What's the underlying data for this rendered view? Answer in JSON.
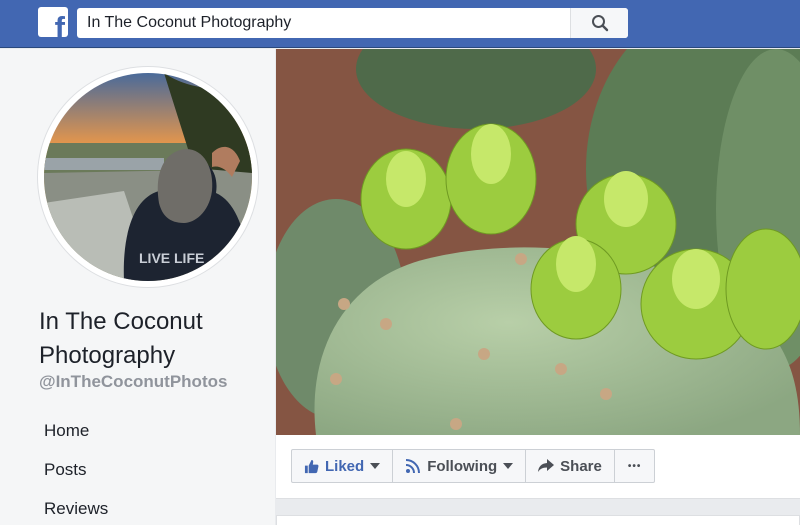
{
  "header": {
    "logo": "facebook-f",
    "search": {
      "value": "In The Coconut Photography",
      "placeholder": "Search"
    },
    "colors": {
      "bar": "#4267b2"
    }
  },
  "profile": {
    "name_line1": "In The Coconut",
    "name_line2": "Photography",
    "handle": "@InTheCoconutPhotos"
  },
  "nav": [
    {
      "label": "Home"
    },
    {
      "label": "Posts"
    },
    {
      "label": "Reviews"
    }
  ],
  "actions": {
    "liked": "Liked",
    "following": "Following",
    "share": "Share",
    "more": "•••"
  },
  "icons": [
    "search-icon",
    "thumbs-up-icon",
    "rss-icon",
    "share-arrow-icon",
    "caret-down-icon",
    "more-icon"
  ]
}
